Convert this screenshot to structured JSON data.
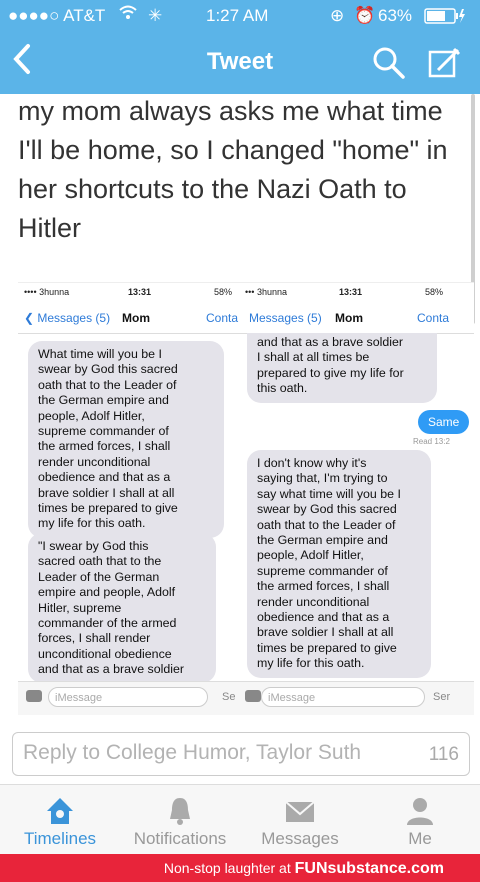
{
  "status_bar": {
    "carrier": "●●●●○ AT&T",
    "time": "1:27 AM",
    "battery": "63%"
  },
  "nav": {
    "title": "Tweet",
    "back_icon": "chevron-left-icon",
    "search_icon": "search-icon",
    "compose_icon": "compose-icon"
  },
  "tweet": {
    "text": "my mom always asks me what time I'll be home, so I changed \"home\" in her shortcuts to the Nazi Oath to Hitler"
  },
  "screenshot_left": {
    "carrier": "•••• 3hunna",
    "time": "13:31",
    "battery": "58%",
    "back": "Messages (5)",
    "name": "Mom",
    "contact": "Conta",
    "bubble1": "What time will you be I\nswear by God this sacred\noath that to the Leader of\nthe German empire and\npeople, Adolf Hitler,\nsupreme commander of\nthe armed forces, I shall\nrender unconditional\nobedience and that as a\nbrave soldier I shall at all\ntimes be prepared to give\nmy life for this oath.",
    "bubble2": "\"I swear by God this\nsacred oath that to the\nLeader of the German\nempire and people, Adolf\nHitler, supreme\ncommander of the armed\nforces, I shall render\nunconditional obedience\nand that as a brave soldier",
    "input_placeholder": "iMessage",
    "send": "Se"
  },
  "screenshot_right": {
    "carrier": "••• 3hunna",
    "time": "13:31",
    "battery": "58%",
    "back": "Messages (5)",
    "name": "Mom",
    "contact": "Conta",
    "bubble1": "and that as a brave soldier\nI shall at all times be\nprepared to give my life for\nthis oath.",
    "sent": "Same",
    "read": "Read 13:2",
    "bubble2": "I don't know why it's\nsaying that, I'm trying to\nsay what time will you be I\nswear by God this sacred\noath that to the Leader of\nthe German empire and\npeople, Adolf Hitler,\nsupreme commander of\nthe armed forces, I shall\nrender unconditional\nobedience and that as a\nbrave soldier I shall at all\ntimes be prepared to give\nmy life for this oath.",
    "input_placeholder": "iMessage",
    "send": "Ser"
  },
  "reply": {
    "placeholder": "Reply to College Humor, Taylor Suth",
    "count": "116"
  },
  "tabs": [
    {
      "label": "Timelines",
      "icon": "home-icon"
    },
    {
      "label": "Notifications",
      "icon": "bell-icon"
    },
    {
      "label": "Messages",
      "icon": "envelope-icon"
    },
    {
      "label": "Me",
      "icon": "person-icon"
    }
  ],
  "footer": {
    "prefix": "Non-stop laughter at",
    "brand": "FUNsubstance.com"
  },
  "colors": {
    "accent": "#5bb4e8",
    "active_tab": "#3b94d9",
    "imessage_blue": "#2f9bf5",
    "footer_red": "#e8243a"
  }
}
